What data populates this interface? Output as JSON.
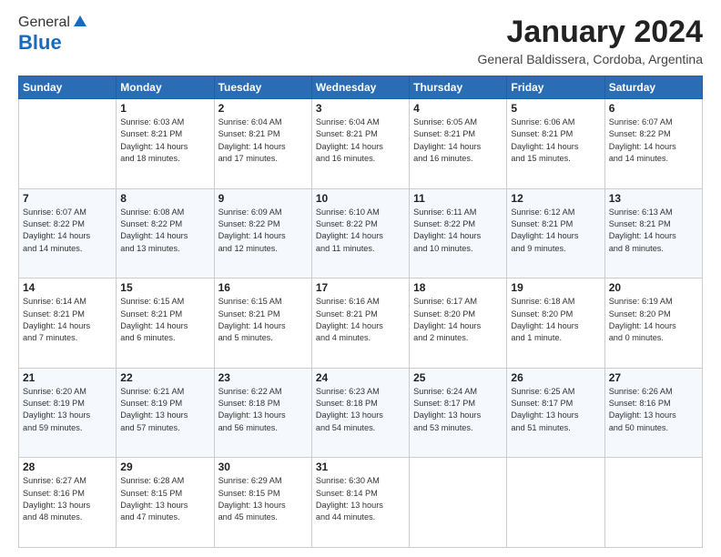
{
  "logo": {
    "general": "General",
    "blue": "Blue"
  },
  "title": "January 2024",
  "subtitle": "General Baldissera, Cordoba, Argentina",
  "days_of_week": [
    "Sunday",
    "Monday",
    "Tuesday",
    "Wednesday",
    "Thursday",
    "Friday",
    "Saturday"
  ],
  "weeks": [
    [
      {
        "day": "",
        "info": ""
      },
      {
        "day": "1",
        "info": "Sunrise: 6:03 AM\nSunset: 8:21 PM\nDaylight: 14 hours\nand 18 minutes."
      },
      {
        "day": "2",
        "info": "Sunrise: 6:04 AM\nSunset: 8:21 PM\nDaylight: 14 hours\nand 17 minutes."
      },
      {
        "day": "3",
        "info": "Sunrise: 6:04 AM\nSunset: 8:21 PM\nDaylight: 14 hours\nand 16 minutes."
      },
      {
        "day": "4",
        "info": "Sunrise: 6:05 AM\nSunset: 8:21 PM\nDaylight: 14 hours\nand 16 minutes."
      },
      {
        "day": "5",
        "info": "Sunrise: 6:06 AM\nSunset: 8:21 PM\nDaylight: 14 hours\nand 15 minutes."
      },
      {
        "day": "6",
        "info": "Sunrise: 6:07 AM\nSunset: 8:22 PM\nDaylight: 14 hours\nand 14 minutes."
      }
    ],
    [
      {
        "day": "7",
        "info": "Sunrise: 6:07 AM\nSunset: 8:22 PM\nDaylight: 14 hours\nand 14 minutes."
      },
      {
        "day": "8",
        "info": "Sunrise: 6:08 AM\nSunset: 8:22 PM\nDaylight: 14 hours\nand 13 minutes."
      },
      {
        "day": "9",
        "info": "Sunrise: 6:09 AM\nSunset: 8:22 PM\nDaylight: 14 hours\nand 12 minutes."
      },
      {
        "day": "10",
        "info": "Sunrise: 6:10 AM\nSunset: 8:22 PM\nDaylight: 14 hours\nand 11 minutes."
      },
      {
        "day": "11",
        "info": "Sunrise: 6:11 AM\nSunset: 8:22 PM\nDaylight: 14 hours\nand 10 minutes."
      },
      {
        "day": "12",
        "info": "Sunrise: 6:12 AM\nSunset: 8:21 PM\nDaylight: 14 hours\nand 9 minutes."
      },
      {
        "day": "13",
        "info": "Sunrise: 6:13 AM\nSunset: 8:21 PM\nDaylight: 14 hours\nand 8 minutes."
      }
    ],
    [
      {
        "day": "14",
        "info": "Sunrise: 6:14 AM\nSunset: 8:21 PM\nDaylight: 14 hours\nand 7 minutes."
      },
      {
        "day": "15",
        "info": "Sunrise: 6:15 AM\nSunset: 8:21 PM\nDaylight: 14 hours\nand 6 minutes."
      },
      {
        "day": "16",
        "info": "Sunrise: 6:15 AM\nSunset: 8:21 PM\nDaylight: 14 hours\nand 5 minutes."
      },
      {
        "day": "17",
        "info": "Sunrise: 6:16 AM\nSunset: 8:21 PM\nDaylight: 14 hours\nand 4 minutes."
      },
      {
        "day": "18",
        "info": "Sunrise: 6:17 AM\nSunset: 8:20 PM\nDaylight: 14 hours\nand 2 minutes."
      },
      {
        "day": "19",
        "info": "Sunrise: 6:18 AM\nSunset: 8:20 PM\nDaylight: 14 hours\nand 1 minute."
      },
      {
        "day": "20",
        "info": "Sunrise: 6:19 AM\nSunset: 8:20 PM\nDaylight: 14 hours\nand 0 minutes."
      }
    ],
    [
      {
        "day": "21",
        "info": "Sunrise: 6:20 AM\nSunset: 8:19 PM\nDaylight: 13 hours\nand 59 minutes."
      },
      {
        "day": "22",
        "info": "Sunrise: 6:21 AM\nSunset: 8:19 PM\nDaylight: 13 hours\nand 57 minutes."
      },
      {
        "day": "23",
        "info": "Sunrise: 6:22 AM\nSunset: 8:18 PM\nDaylight: 13 hours\nand 56 minutes."
      },
      {
        "day": "24",
        "info": "Sunrise: 6:23 AM\nSunset: 8:18 PM\nDaylight: 13 hours\nand 54 minutes."
      },
      {
        "day": "25",
        "info": "Sunrise: 6:24 AM\nSunset: 8:17 PM\nDaylight: 13 hours\nand 53 minutes."
      },
      {
        "day": "26",
        "info": "Sunrise: 6:25 AM\nSunset: 8:17 PM\nDaylight: 13 hours\nand 51 minutes."
      },
      {
        "day": "27",
        "info": "Sunrise: 6:26 AM\nSunset: 8:16 PM\nDaylight: 13 hours\nand 50 minutes."
      }
    ],
    [
      {
        "day": "28",
        "info": "Sunrise: 6:27 AM\nSunset: 8:16 PM\nDaylight: 13 hours\nand 48 minutes."
      },
      {
        "day": "29",
        "info": "Sunrise: 6:28 AM\nSunset: 8:15 PM\nDaylight: 13 hours\nand 47 minutes."
      },
      {
        "day": "30",
        "info": "Sunrise: 6:29 AM\nSunset: 8:15 PM\nDaylight: 13 hours\nand 45 minutes."
      },
      {
        "day": "31",
        "info": "Sunrise: 6:30 AM\nSunset: 8:14 PM\nDaylight: 13 hours\nand 44 minutes."
      },
      {
        "day": "",
        "info": ""
      },
      {
        "day": "",
        "info": ""
      },
      {
        "day": "",
        "info": ""
      }
    ]
  ]
}
